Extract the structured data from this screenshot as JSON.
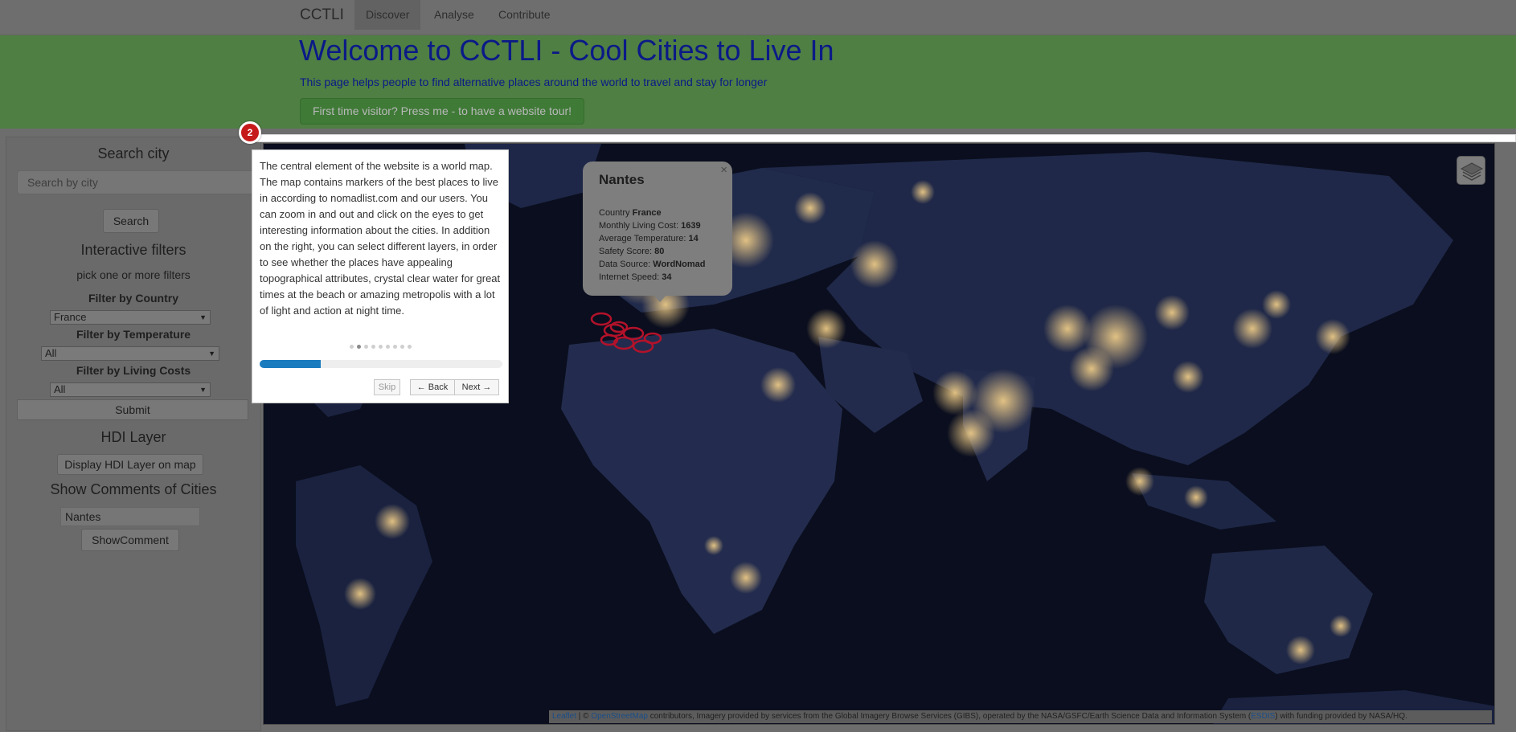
{
  "navbar": {
    "brand": "CCTLI",
    "items": [
      {
        "label": "Discover",
        "active": true
      },
      {
        "label": "Analyse",
        "active": false
      },
      {
        "label": "Contribute",
        "active": false
      }
    ]
  },
  "hero": {
    "title": "Welcome to CCTLI - Cool Cities to Live In",
    "subtitle": "This page helps people to find alternative places around the world to travel and stay for longer",
    "tour_button": "First time visitor? Press me - to have a website tour!"
  },
  "sidebar": {
    "search_heading": "Search city",
    "search_placeholder": "Search by city",
    "search_button": "Search",
    "filters_heading": "Interactive filters",
    "filters_hint": "pick one or more filters",
    "country_label": "Filter by Country",
    "country_value": "France",
    "temperature_label": "Filter by Temperature",
    "temperature_value": "All",
    "living_costs_label": "Filter by Living Costs",
    "living_costs_value": "All",
    "submit_button": "Submit",
    "hdi_heading": "HDI Layer",
    "hdi_button": "Display HDI Layer on map",
    "comments_heading": "Show Comments of Cities",
    "comments_value": "Nantes",
    "comments_button": "ShowComment"
  },
  "popup": {
    "title": "Nantes",
    "close": "×",
    "rows": [
      {
        "label": "Country",
        "value": "France"
      },
      {
        "label": "Monthly Living Cost:",
        "value": "1639"
      },
      {
        "label": "Average Temperature:",
        "value": "14"
      },
      {
        "label": "Safety Score:",
        "value": "80"
      },
      {
        "label": "Data Source:",
        "value": "WordNomad"
      },
      {
        "label": "Internet Speed:",
        "value": "34"
      }
    ]
  },
  "tour": {
    "step": "2",
    "text": "The central element of the website is a world map. The map contains markers of the best places to live in according to nomadlist.com and our users. You can zoom in and out and click on the eyes to get interesting information about the cities. In addition on the right, you can select different layers, in order to see whether the places have appealing topographical attributes, crystal clear water for great times at the beach or amazing metropolis with a lot of light and action at night time.",
    "total_steps": 9,
    "current_step": 2,
    "progress": 0.25,
    "skip": "Skip",
    "back": "← Back",
    "next": "Next →"
  },
  "attribution": {
    "leaflet": "Leaflet",
    "sep": " | © ",
    "osm": "OpenStreetMap",
    "text1": " contributors, Imagery provided by services from the Global Imagery Browse Services (GIBS), operated by the NASA/GSFC/Earth Science Data and Information System (",
    "esdis": "ESDIS",
    "text2": ") with funding provided by NASA/HQ."
  },
  "colors": {
    "accent_green": "#4f7f43",
    "title_blue": "#0b1a87",
    "progress_blue": "#1a7bbf",
    "marker_red": "#b3122a",
    "tour_badge_red": "#c61a1a"
  },
  "icons": {
    "layers": "layers-icon",
    "marker": "eye-marker-icon",
    "close": "close-icon"
  }
}
